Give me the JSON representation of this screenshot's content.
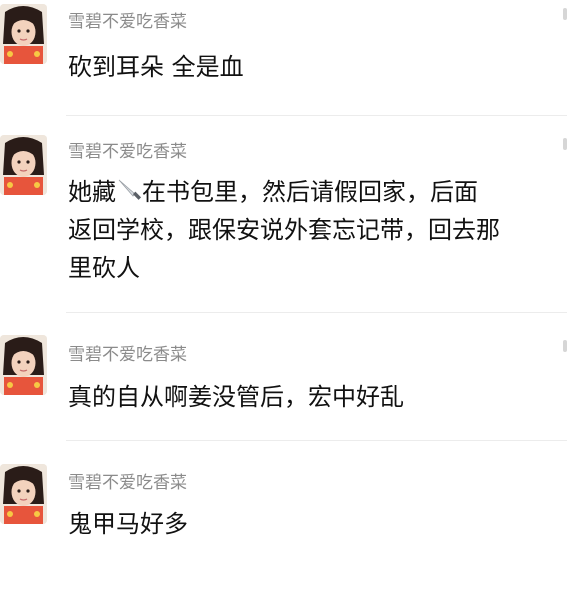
{
  "comments": [
    {
      "username": "雪碧不爱吃香菜",
      "lines": [
        "砍到耳朵 全是血"
      ]
    },
    {
      "username": "雪碧不爱吃香菜",
      "line1_before": "她藏",
      "line1_after": "在书包里，然后请假回家，后面",
      "lines": [
        "返回学校，跟保安说外套忘记带，回去那",
        "里砍人"
      ],
      "icon": "knife-emoji"
    },
    {
      "username": "雪碧不爱吃香菜",
      "lines": [
        "真的自从啊姜没管后，宏中好乱"
      ]
    },
    {
      "username": "雪碧不爱吃香菜",
      "lines": [
        "鬼甲马好多"
      ]
    }
  ]
}
